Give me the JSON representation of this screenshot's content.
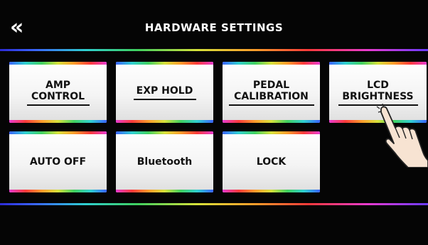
{
  "header": {
    "back_label": "«",
    "title": "HARDWARE SETTINGS"
  },
  "buttons": [
    {
      "line1": "AMP",
      "line2": "CONTROL",
      "selected": true
    },
    {
      "line1": "EXP HOLD",
      "line2": "",
      "selected": true
    },
    {
      "line1": "PEDAL",
      "line2": "CALIBRATION",
      "selected": true
    },
    {
      "line1": "LCD",
      "line2": "BRIGHTNESS",
      "selected": true
    },
    {
      "line1": "AUTO OFF",
      "line2": "",
      "selected": false
    },
    {
      "line1": "Bluetooth",
      "line2": "",
      "selected": false
    },
    {
      "line1": "LOCK",
      "line2": "",
      "selected": false
    }
  ],
  "colors": {
    "background": "#050505",
    "button": "#f4f4f4",
    "text": "#111111"
  },
  "icons": {
    "back": "double-chevron-left-icon",
    "pointer": "pointing-hand-icon"
  }
}
